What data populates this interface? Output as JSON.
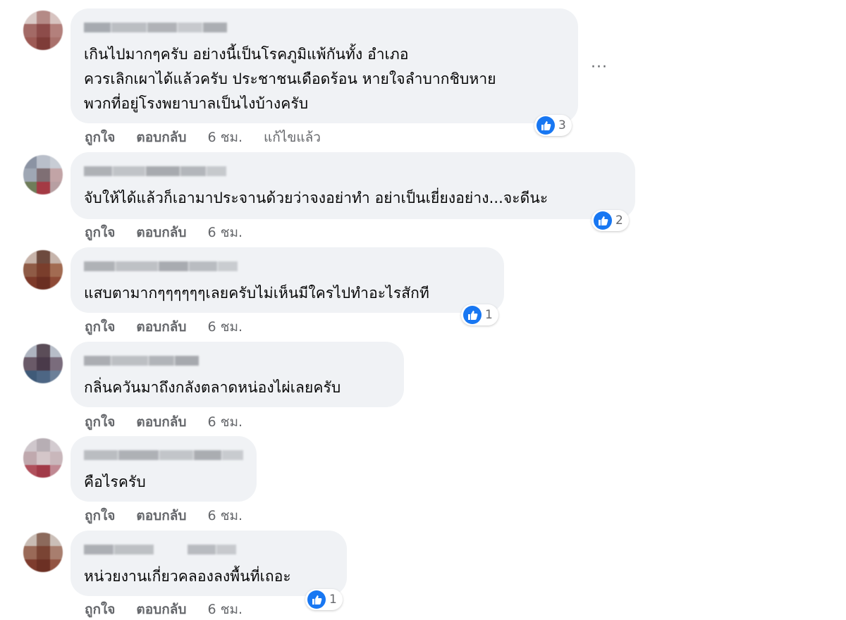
{
  "comments": [
    {
      "text_lines": [
        "เกินไปมากๆครับ อย่างนี้เป็นโรคภูมิแพ้กันทั้ง อำเภอ",
        "ควรเลิกเผาได้แล้วครับ ประชาชนเดือดร้อน หายใจลำบากชิบหาย",
        "พวกที่อยู่โรงพยาบาลเป็นไงบ้างครับ"
      ],
      "like_label": "ถูกใจ",
      "reply_label": "ตอบกลับ",
      "time": "6 ชม.",
      "edited": "แก้ไขแล้ว",
      "reaction_count": "3",
      "more_label": "···"
    },
    {
      "text_lines": [
        "จับให้ได้แล้วก็เอามาประจานด้วยว่าจงอย่าทำ อย่าเป็นเยี่ยงอย่าง...จะดีนะ"
      ],
      "like_label": "ถูกใจ",
      "reply_label": "ตอบกลับ",
      "time": "6 ชม.",
      "reaction_count": "2"
    },
    {
      "text_lines": [
        "แสบตามากๆๆๆๆๆๆเลยครับไม่เห็นมีใครไปทำอะไรสักที"
      ],
      "like_label": "ถูกใจ",
      "reply_label": "ตอบกลับ",
      "time": "6 ชม.",
      "reaction_count": "1"
    },
    {
      "text_lines": [
        "กลิ่นควันมาถึงกลังตลาดหน่องไผ่เลยครับ"
      ],
      "like_label": "ถูกใจ",
      "reply_label": "ตอบกลับ",
      "time": "6 ชม."
    },
    {
      "text_lines": [
        "คือไรครับ"
      ],
      "like_label": "ถูกใจ",
      "reply_label": "ตอบกลับ",
      "time": "6 ชม."
    },
    {
      "text_lines": [
        "หน่วยงานเกี่ยวคลองลงพื้นที่เถอะ"
      ],
      "like_label": "ถูกใจ",
      "reply_label": "ตอบกลับ",
      "time": "6 ชม.",
      "reaction_count": "1"
    }
  ],
  "colors": {
    "bubble_bg": "#f0f2f5",
    "like_blue": "#1877f2",
    "secondary_text": "#65676b"
  },
  "icons": {
    "reaction": "like-thumb-icon",
    "avatar": "blurred-profile-avatar",
    "name": "blurred-username"
  }
}
